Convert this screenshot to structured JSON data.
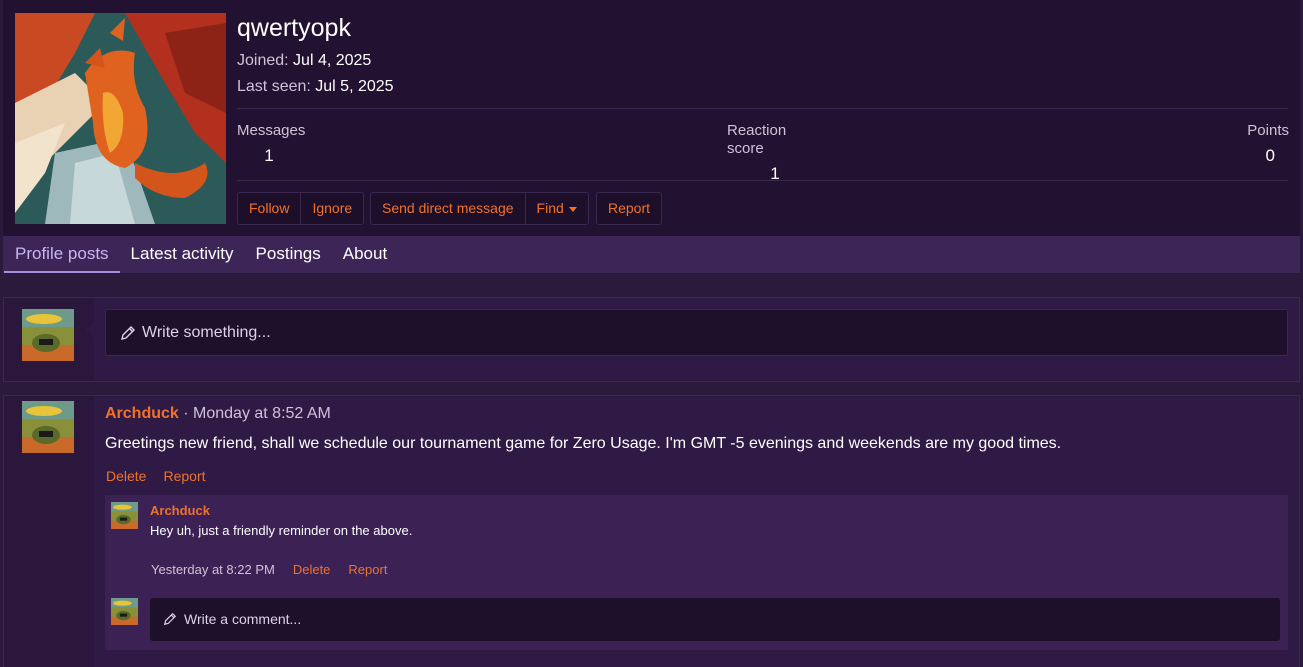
{
  "profile": {
    "username": "qwertyopk",
    "joined_label": "Joined:",
    "joined_value": "Jul 4, 2025",
    "last_seen_label": "Last seen:",
    "last_seen_value": "Jul 5, 2025",
    "avatar_icon": "dragon-avatar",
    "stats": {
      "messages_label": "Messages",
      "messages_value": "1",
      "reaction_label": "Reaction score",
      "reaction_value": "1",
      "points_label": "Points",
      "points_value": "0"
    },
    "buttons": {
      "follow": "Follow",
      "ignore": "Ignore",
      "send_dm": "Send direct message",
      "find": "Find",
      "report": "Report"
    }
  },
  "tabs": [
    {
      "label": "Profile posts",
      "active": true
    },
    {
      "label": "Latest activity",
      "active": false
    },
    {
      "label": "Postings",
      "active": false
    },
    {
      "label": "About",
      "active": false
    }
  ],
  "composer": {
    "placeholder": "Write something..."
  },
  "post": {
    "author": "Archduck",
    "separator": " · ",
    "time": "Monday at 8:52 AM",
    "text": "Greetings new friend, shall we schedule our tournament game for Zero Usage. I'm GMT -5 evenings and weekends are my good times.",
    "delete_label": "Delete",
    "report_label": "Report",
    "comment": {
      "author": "Archduck",
      "text": "Hey uh, just a friendly reminder on the above.",
      "time": "Yesterday at 8:22 PM",
      "delete_label": "Delete",
      "report_label": "Report"
    },
    "comment_placeholder": "Write a comment..."
  },
  "colors": {
    "accent": "#f0722a",
    "background": "#2c1a3c",
    "header_bg": "#221130",
    "tabs_bg": "#3e2558"
  }
}
